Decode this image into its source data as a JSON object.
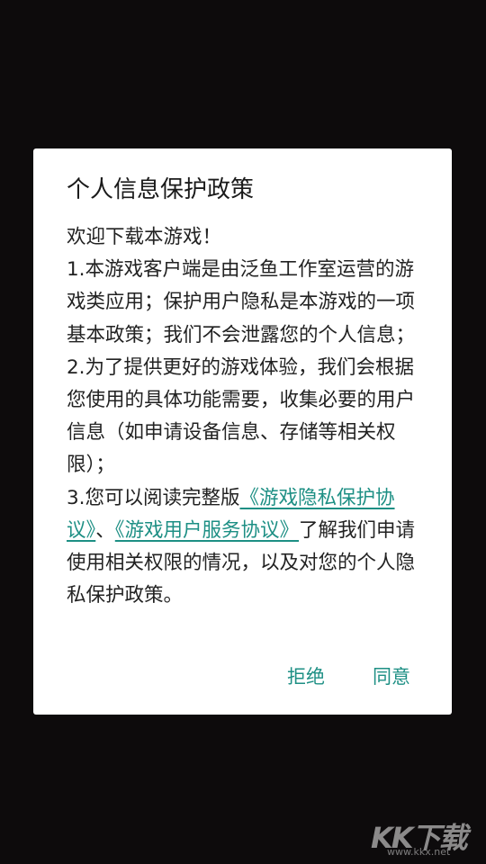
{
  "dialog": {
    "title": "个人信息保护政策",
    "greeting": "欢迎下载本游戏！",
    "para1": "1.本游戏客户端是由泛鱼工作室运营的游戏类应用；保护用户隐私是本游戏的一项基本政策；我们不会泄露您的个人信息；",
    "para2": "2.为了提供更好的游戏体验，我们会根据您使用的具体功能需要，收集必要的用户信息（如申请设备信息、存储等相关权限）；",
    "para3_prefix": "3.您可以阅读完整版",
    "privacy_link": "《游戏隐私保护协议》",
    "separator": "、",
    "service_link": "《游戏用户服务协议》",
    "para3_suffix": "了解我们申请使用相关权限的情况，以及对您的个人隐私保护政策。",
    "reject_label": "拒绝",
    "agree_label": "同意"
  },
  "watermark": {
    "logo_text": "KK下载",
    "url": "www.kkx.net"
  },
  "colors": {
    "background": "#0d0b0c",
    "dialog_bg": "#ffffff",
    "accent": "#1d8f84",
    "text": "#222222"
  }
}
